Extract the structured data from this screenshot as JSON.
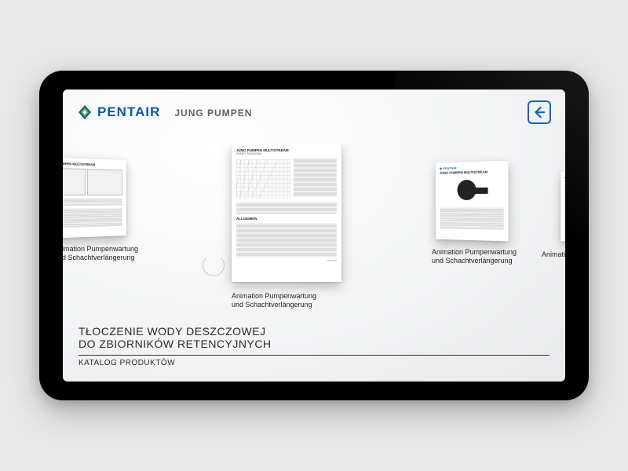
{
  "brand": {
    "name": "PENTAIR",
    "sub": "JUNG PUMPEN"
  },
  "icons": {
    "back": "arrow-left-box-icon"
  },
  "gallery": {
    "items": [
      {
        "caption_line1": "nimation Pumpenwartung",
        "caption_line2": "nd Schachtverlängerung",
        "doc_title": "JUNG PUMPEN MULTISTREAM"
      },
      {
        "caption_line1": "Animation Pumpenwartung",
        "caption_line2": "und Schachtverlängerung",
        "doc_title": "JUNG PUMPEN MULTISTREAM",
        "doc_sub": "POMPY ŚCIEKOWE"
      },
      {
        "caption_line1": "Animation Pumpenwartung",
        "caption_line2": "und Schachtverlängerung",
        "doc_title": "JUNG PUMPEN MULTISTREAM"
      },
      {
        "caption_line1": "Animation Pumpenwartung",
        "caption_line2": "und Schachtverlängerung"
      }
    ]
  },
  "footer": {
    "heading_line1": "Tłoczenie wody deszczowej",
    "heading_line2": "do zbiorników retencyjnych",
    "sub": "Katalog produktów"
  }
}
